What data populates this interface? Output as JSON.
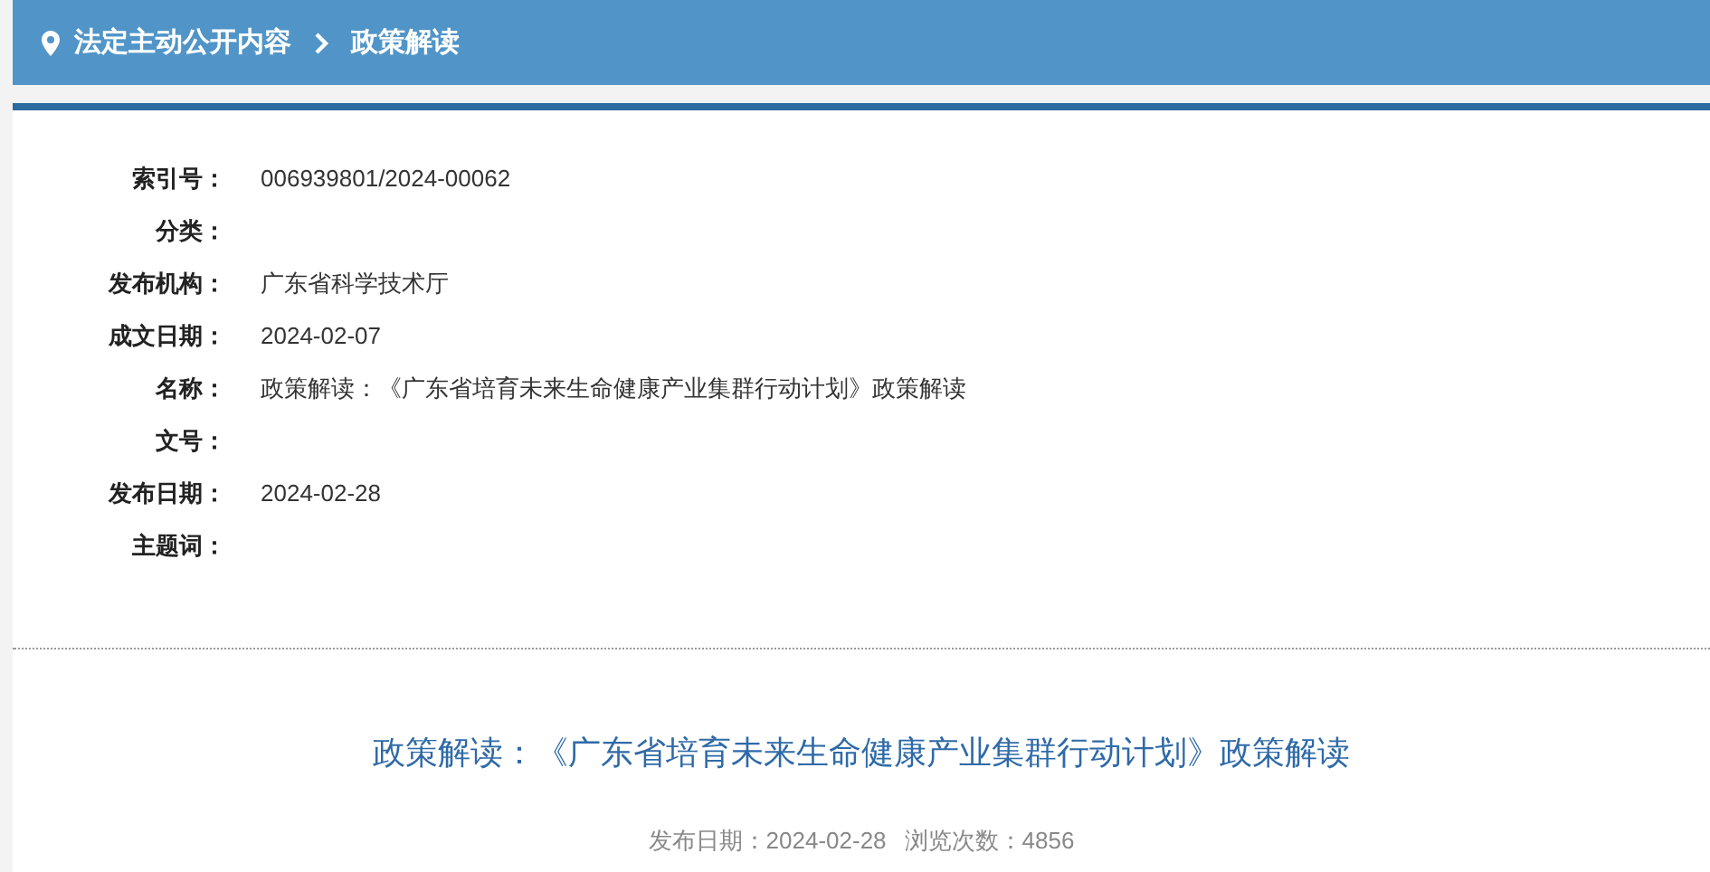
{
  "breadcrumb": {
    "items": [
      {
        "label": "法定主动公开内容"
      },
      {
        "label": "政策解读"
      }
    ]
  },
  "info": [
    {
      "label": "索引号：",
      "value": "006939801/2024-00062"
    },
    {
      "label": "分类："
    },
    {
      "label": "发布机构：",
      "value": "广东省科学技术厅"
    },
    {
      "label": "成文日期：",
      "value": "2024-02-07"
    },
    {
      "label": "名称：",
      "value": "政策解读：《广东省培育未来生命健康产业集群行动计划》政策解读"
    },
    {
      "label": "文号："
    },
    {
      "label": "发布日期：",
      "value": "2024-02-28"
    },
    {
      "label": "主题词："
    }
  ],
  "article": {
    "title": "政策解读：《广东省培育未来生命健康产业集群行动计划》政策解读",
    "meta": [
      "发布日期：2024-02-28",
      "浏览次数：4856"
    ]
  }
}
